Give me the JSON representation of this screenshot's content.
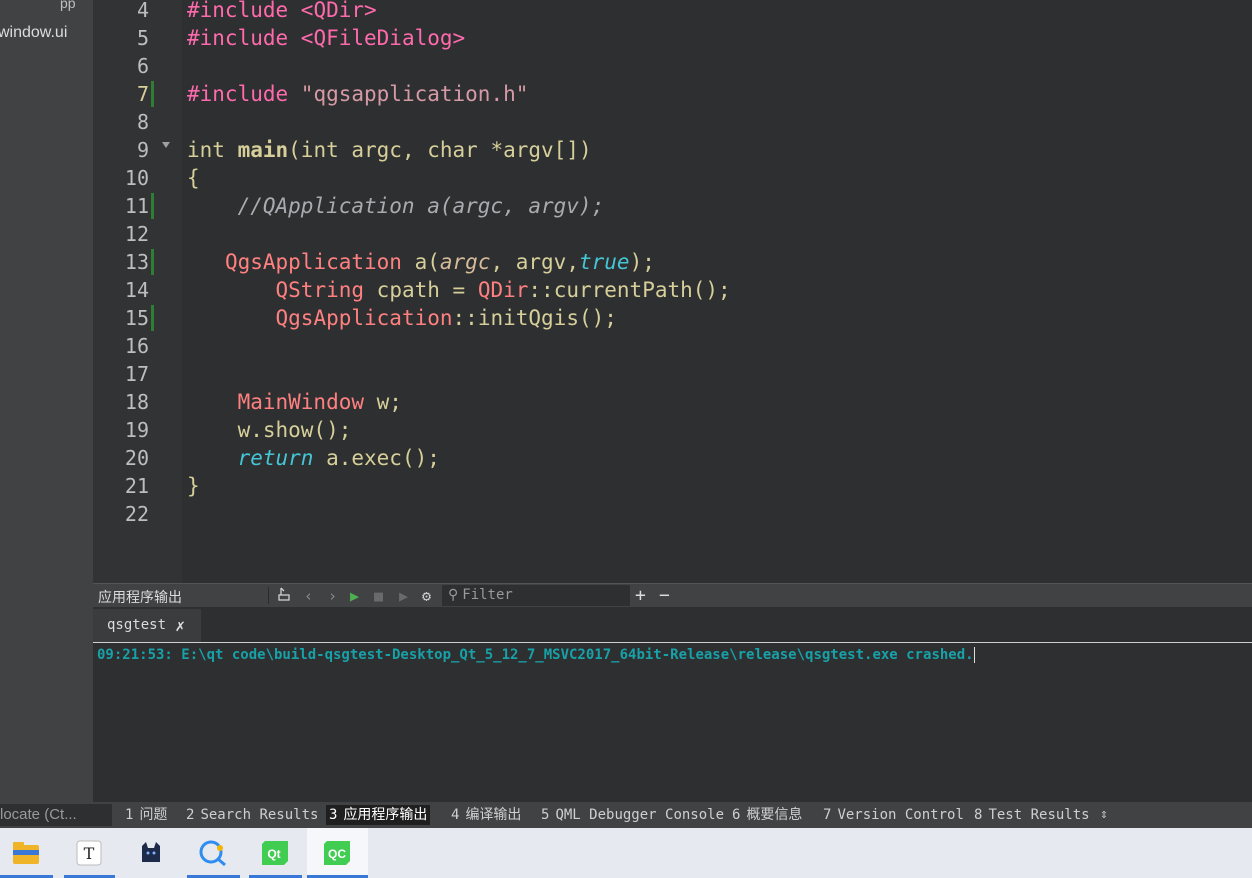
{
  "sidebar": {
    "top_fragment": "pp",
    "file_item": "window.ui"
  },
  "editor": {
    "current_line": 7,
    "line_numbers": [
      "4",
      "5",
      "6",
      "7",
      "8",
      "9",
      "10",
      "11",
      "12",
      "13",
      "14",
      "15",
      "16",
      "17",
      "18",
      "19",
      "20",
      "21",
      "22"
    ],
    "code": {
      "l4_dir": "#include",
      "l4_arg": " <QDir>",
      "l5_dir": "#include",
      "l5_arg": " <QFileDialog>",
      "l7_dir": "#include",
      "l7_str": " \"qgsapplication.h\"",
      "l9_type": "int ",
      "l9_fn": "main",
      "l9_rest": "(int argc, char *argv[])",
      "l10": "{",
      "l11": "    //QApplication a(argc, argv);",
      "l13_indent": "   ",
      "l13_cls": "QgsApplication",
      "l13_var": " a(",
      "l13_p1": "argc",
      "l13_mid": ", argv,",
      "l13_lit": "true",
      "l13_end": ");",
      "l14_indent": "       ",
      "l14_cls": "QString",
      "l14_mid": " cpath = ",
      "l14_cls2": "QDir",
      "l14_end": "::currentPath();",
      "l15_indent": "       ",
      "l15_cls": "QgsApplication",
      "l15_end": "::initQgis();",
      "l18_indent": "    ",
      "l18_cls": "MainWindow",
      "l18_end": " w;",
      "l19": "    w.show();",
      "l20_indent": "    ",
      "l20_kw": "return",
      "l20_end": " a.exec();",
      "l21": "}"
    }
  },
  "output_pane": {
    "title": "应用程序输出",
    "filter_placeholder": "Filter",
    "plus": "+",
    "minus": "−",
    "tab_label": "qsgtest",
    "tab_close": "✗",
    "message": "09:21:53: E:\\qt code\\build-qsgtest-Desktop_Qt_5_12_7_MSVC2017_64bit-Release\\release\\qsgtest.exe crashed."
  },
  "statusbar": {
    "locator_placeholder": "locate (Ct...",
    "panes": [
      {
        "num": "1",
        "label": "问题"
      },
      {
        "num": "2",
        "label": "Search Results"
      },
      {
        "num": "3",
        "label": "应用程序输出"
      },
      {
        "num": "4",
        "label": "编译输出"
      },
      {
        "num": "5",
        "label": "QML Debugger Console"
      },
      {
        "num": "6",
        "label": "概要信息"
      },
      {
        "num": "7",
        "label": "Version Control"
      },
      {
        "num": "8",
        "label": "Test Results"
      }
    ],
    "active_pane": "3",
    "arrows": "⇕"
  },
  "taskbar": {
    "icons": [
      "file-explorer-icon",
      "typora-icon",
      "cat-app-icon",
      "search-chat-icon",
      "qt-designer-icon",
      "qt-creator-icon"
    ],
    "accent": "#3a78d8"
  },
  "colors": {
    "preprocessor": "#ff6aad",
    "class": "#ff8080",
    "comment": "#a8abb0",
    "literal": "#45c6d6",
    "output_message": "#17a1a8"
  }
}
